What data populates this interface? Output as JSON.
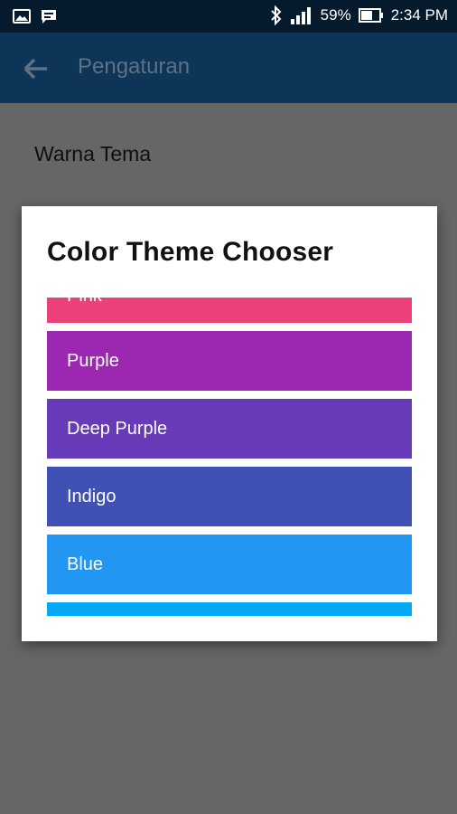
{
  "status_bar": {
    "battery": "59%",
    "time": "2:34 PM"
  },
  "app_bar": {
    "title": "Pengaturan"
  },
  "preference": {
    "title": "Warna Tema"
  },
  "dialog": {
    "title": "Color Theme Chooser",
    "options": [
      {
        "label": "Pink",
        "color": "#ec407a"
      },
      {
        "label": "Purple",
        "color": "#9c27b0"
      },
      {
        "label": "Deep Purple",
        "color": "#673ab7"
      },
      {
        "label": "Indigo",
        "color": "#3f51b5"
      },
      {
        "label": "Blue",
        "color": "#2196f3"
      },
      {
        "label": "",
        "color": "#03a9f4"
      }
    ]
  },
  "colors": {
    "status_bar_bg": "#051a2c",
    "app_bar_bg": "#0d3557",
    "scrim_bg": "#666666"
  }
}
